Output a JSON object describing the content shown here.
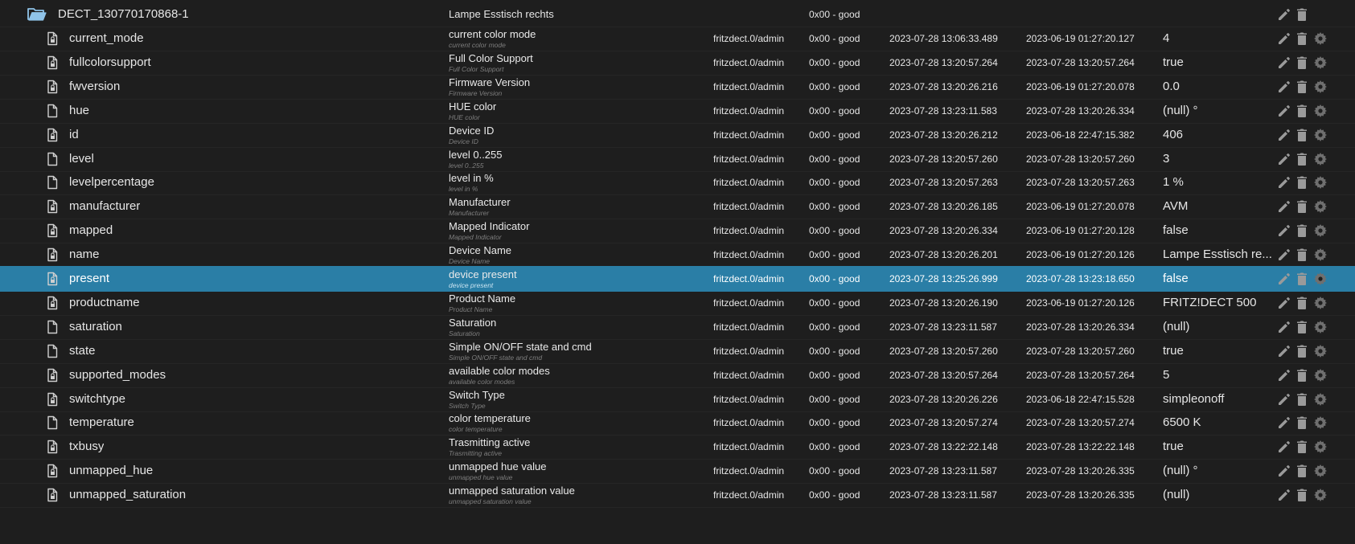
{
  "colors": {
    "background": "#1e1e1e",
    "selected_row": "#2a7ea6",
    "folder": "#8fc3e8",
    "text": "#e6e6e6",
    "muted": "#7e7e7e"
  },
  "folder": {
    "id": "DECT_130770170868-1",
    "name": "Lampe Esstisch rechts",
    "status": "0x00 - good",
    "icon": "folder-open-icon"
  },
  "rows": [
    {
      "id": "current_mode",
      "name": "current color mode",
      "desc": "current color mode",
      "user": "fritzdect.0/admin",
      "status": "0x00 - good",
      "ts": "2023-07-28 13:06:33.489",
      "lc": "2023-06-19 01:27:20.127",
      "value": "4",
      "icon": "file-lock-icon"
    },
    {
      "id": "fullcolorsupport",
      "name": "Full Color Support",
      "desc": "Full Color Support",
      "user": "fritzdect.0/admin",
      "status": "0x00 - good",
      "ts": "2023-07-28 13:20:57.264",
      "lc": "2023-07-28 13:20:57.264",
      "value": "true",
      "icon": "file-lock-icon"
    },
    {
      "id": "fwversion",
      "name": "Firmware Version",
      "desc": "Firmware Version",
      "user": "fritzdect.0/admin",
      "status": "0x00 - good",
      "ts": "2023-07-28 13:20:26.216",
      "lc": "2023-06-19 01:27:20.078",
      "value": "0.0",
      "icon": "file-lock-icon"
    },
    {
      "id": "hue",
      "name": "HUE color",
      "desc": "HUE color",
      "user": "fritzdect.0/admin",
      "status": "0x00 - good",
      "ts": "2023-07-28 13:23:11.583",
      "lc": "2023-07-28 13:20:26.334",
      "value": "(null) °",
      "icon": "file-icon"
    },
    {
      "id": "id",
      "name": "Device ID",
      "desc": "Device ID",
      "user": "fritzdect.0/admin",
      "status": "0x00 - good",
      "ts": "2023-07-28 13:20:26.212",
      "lc": "2023-06-18 22:47:15.382",
      "value": "406",
      "icon": "file-lock-icon"
    },
    {
      "id": "level",
      "name": "level 0..255",
      "desc": "level 0..255",
      "user": "fritzdect.0/admin",
      "status": "0x00 - good",
      "ts": "2023-07-28 13:20:57.260",
      "lc": "2023-07-28 13:20:57.260",
      "value": "3",
      "icon": "file-icon"
    },
    {
      "id": "levelpercentage",
      "name": "level in %",
      "desc": "level in %",
      "user": "fritzdect.0/admin",
      "status": "0x00 - good",
      "ts": "2023-07-28 13:20:57.263",
      "lc": "2023-07-28 13:20:57.263",
      "value": "1 %",
      "icon": "file-icon"
    },
    {
      "id": "manufacturer",
      "name": "Manufacturer",
      "desc": "Manufacturer",
      "user": "fritzdect.0/admin",
      "status": "0x00 - good",
      "ts": "2023-07-28 13:20:26.185",
      "lc": "2023-06-19 01:27:20.078",
      "value": "AVM",
      "icon": "file-lock-icon"
    },
    {
      "id": "mapped",
      "name": "Mapped Indicator",
      "desc": "Mapped Indicator",
      "user": "fritzdect.0/admin",
      "status": "0x00 - good",
      "ts": "2023-07-28 13:20:26.334",
      "lc": "2023-06-19 01:27:20.128",
      "value": "false",
      "icon": "file-lock-icon"
    },
    {
      "id": "name",
      "name": "Device Name",
      "desc": "Device Name",
      "user": "fritzdect.0/admin",
      "status": "0x00 - good",
      "ts": "2023-07-28 13:20:26.201",
      "lc": "2023-06-19 01:27:20.126",
      "value": "Lampe Esstisch re...",
      "icon": "file-lock-icon"
    },
    {
      "id": "present",
      "name": "device present",
      "desc": "device present",
      "user": "fritzdect.0/admin",
      "status": "0x00 - good",
      "ts": "2023-07-28 13:25:26.999",
      "lc": "2023-07-28 13:23:18.650",
      "value": "false",
      "icon": "file-lock-icon",
      "selected": true
    },
    {
      "id": "productname",
      "name": "Product Name",
      "desc": "Product Name",
      "user": "fritzdect.0/admin",
      "status": "0x00 - good",
      "ts": "2023-07-28 13:20:26.190",
      "lc": "2023-06-19 01:27:20.126",
      "value": "FRITZ!DECT 500",
      "icon": "file-lock-icon"
    },
    {
      "id": "saturation",
      "name": "Saturation",
      "desc": "Saturation",
      "user": "fritzdect.0/admin",
      "status": "0x00 - good",
      "ts": "2023-07-28 13:23:11.587",
      "lc": "2023-07-28 13:20:26.334",
      "value": "(null)",
      "icon": "file-icon"
    },
    {
      "id": "state",
      "name": "Simple ON/OFF state and cmd",
      "desc": "Simple ON/OFF state and cmd",
      "user": "fritzdect.0/admin",
      "status": "0x00 - good",
      "ts": "2023-07-28 13:20:57.260",
      "lc": "2023-07-28 13:20:57.260",
      "value": "true",
      "icon": "file-icon"
    },
    {
      "id": "supported_modes",
      "name": "available color modes",
      "desc": "available color modes",
      "user": "fritzdect.0/admin",
      "status": "0x00 - good",
      "ts": "2023-07-28 13:20:57.264",
      "lc": "2023-07-28 13:20:57.264",
      "value": "5",
      "icon": "file-lock-icon"
    },
    {
      "id": "switchtype",
      "name": "Switch Type",
      "desc": "Switch Type",
      "user": "fritzdect.0/admin",
      "status": "0x00 - good",
      "ts": "2023-07-28 13:20:26.226",
      "lc": "2023-06-18 22:47:15.528",
      "value": "simpleonoff",
      "icon": "file-lock-icon"
    },
    {
      "id": "temperature",
      "name": "color temperature",
      "desc": "color temperature",
      "user": "fritzdect.0/admin",
      "status": "0x00 - good",
      "ts": "2023-07-28 13:20:57.274",
      "lc": "2023-07-28 13:20:57.274",
      "value": "6500 K",
      "icon": "file-icon"
    },
    {
      "id": "txbusy",
      "name": "Trasmitting active",
      "desc": "Trasmitting active",
      "user": "fritzdect.0/admin",
      "status": "0x00 - good",
      "ts": "2023-07-28 13:22:22.148",
      "lc": "2023-07-28 13:22:22.148",
      "value": "true",
      "icon": "file-lock-icon"
    },
    {
      "id": "unmapped_hue",
      "name": "unmapped hue value",
      "desc": "unmapped hue value",
      "user": "fritzdect.0/admin",
      "status": "0x00 - good",
      "ts": "2023-07-28 13:23:11.587",
      "lc": "2023-07-28 13:20:26.335",
      "value": "(null) °",
      "icon": "file-lock-icon"
    },
    {
      "id": "unmapped_saturation",
      "name": "unmapped saturation value",
      "desc": "unmapped saturation value",
      "user": "fritzdect.0/admin",
      "status": "0x00 - good",
      "ts": "2023-07-28 13:23:11.587",
      "lc": "2023-07-28 13:20:26.335",
      "value": "(null)",
      "icon": "file-lock-icon"
    }
  ]
}
